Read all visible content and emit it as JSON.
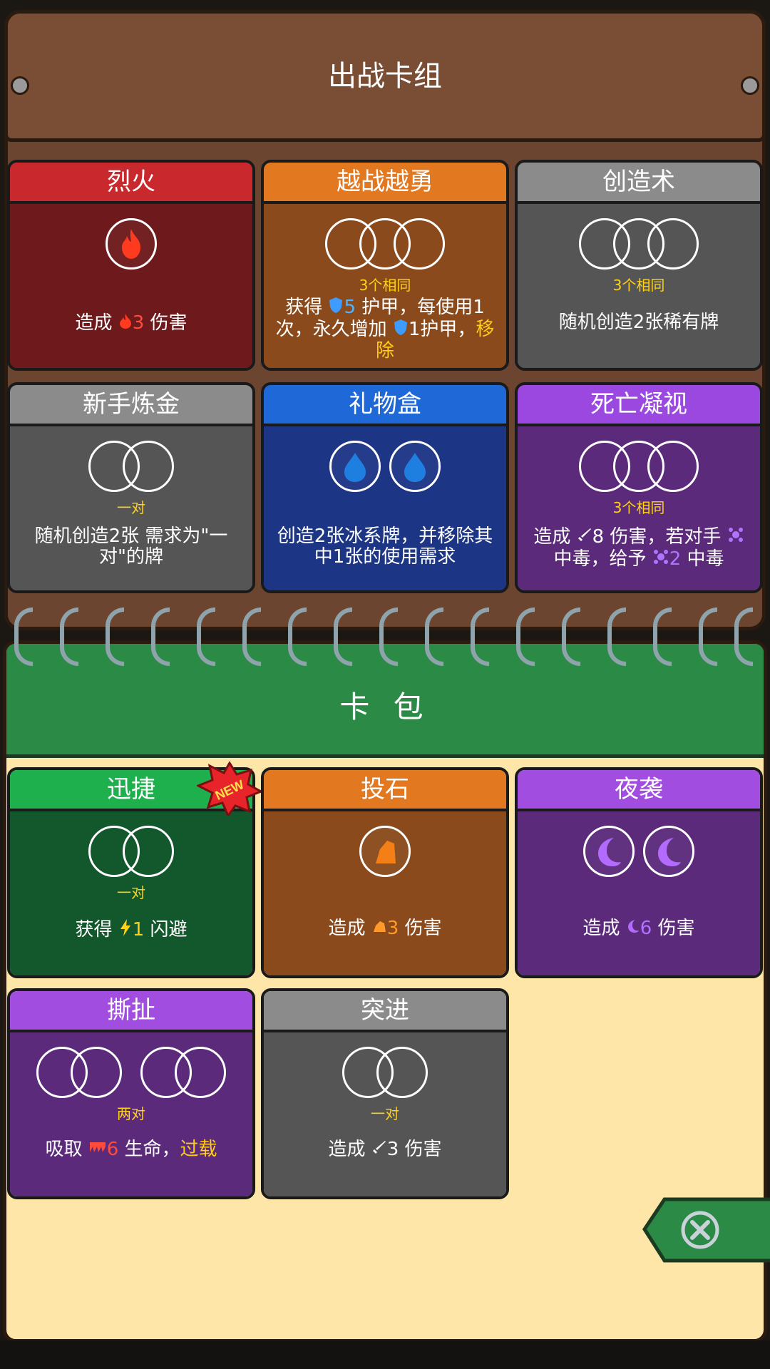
{
  "deck": {
    "title": "出战卡组",
    "cards": [
      {
        "name": "烈火",
        "req": "",
        "desc_a": "造成 ",
        "num": "3",
        "desc_b": " 伤害",
        "head": "#c9282d",
        "body": "#6e1a1c"
      },
      {
        "name": "越战越勇",
        "req": "3个相同",
        "desc_a": "获得 ",
        "num": "5",
        "desc_b": " 护甲，每使用1次，永久增加 ",
        "num2": "1",
        "desc_c": "护甲，",
        "hl": "移除",
        "head": "#e2781f",
        "body": "#8a4a1c"
      },
      {
        "name": "创造术",
        "req": "3个相同",
        "desc": "随机创造2张稀有牌",
        "head": "#8b8b8b",
        "body": "#555555"
      },
      {
        "name": "新手炼金",
        "req": "一对",
        "desc": "随机创造2张 需求为\"一对\"的牌",
        "head": "#8b8b8b",
        "body": "#555555"
      },
      {
        "name": "礼物盒",
        "req": "",
        "desc": "创造2张冰系牌，并移除其中1张的使用需求",
        "head": "#1f68d8",
        "body": "#1c3585"
      },
      {
        "name": "死亡凝视",
        "req": "3个相同",
        "desc_a": "造成 ",
        "num": "8",
        "desc_b": " 伤害，若对手 ",
        "desc_c": "中毒，给予 ",
        "num2": "2",
        "desc_d": " 中毒",
        "head": "#9b48e0",
        "body": "#5b2a7a"
      }
    ]
  },
  "pack": {
    "title": "卡 包",
    "new_badge": "NEW",
    "cards": [
      {
        "name": "迅捷",
        "req": "一对",
        "desc_a": "获得 ",
        "num": "1",
        "desc_b": " 闪避",
        "head": "#1fb04e",
        "body": "#12582c"
      },
      {
        "name": "投石",
        "req": "",
        "desc_a": "造成 ",
        "num": "3",
        "desc_b": " 伤害",
        "head": "#e2781f",
        "body": "#8a4a1c"
      },
      {
        "name": "夜袭",
        "req": "",
        "desc_a": "造成 ",
        "num": "6",
        "desc_b": " 伤害",
        "head": "#a14ee0",
        "body": "#5b2a7a"
      },
      {
        "name": "撕扯",
        "req": "两对",
        "desc_a": "吸取 ",
        "num": "6",
        "desc_b": " 生命，",
        "hl": "过载",
        "head": "#a14ee0",
        "body": "#5b2a7a"
      },
      {
        "name": "突进",
        "req": "一对",
        "desc_a": "造成 ",
        "num": "3",
        "desc_b": " 伤害",
        "head": "#8b8b8b",
        "body": "#555555"
      }
    ]
  },
  "icons": {
    "close": "close-x-icon"
  }
}
